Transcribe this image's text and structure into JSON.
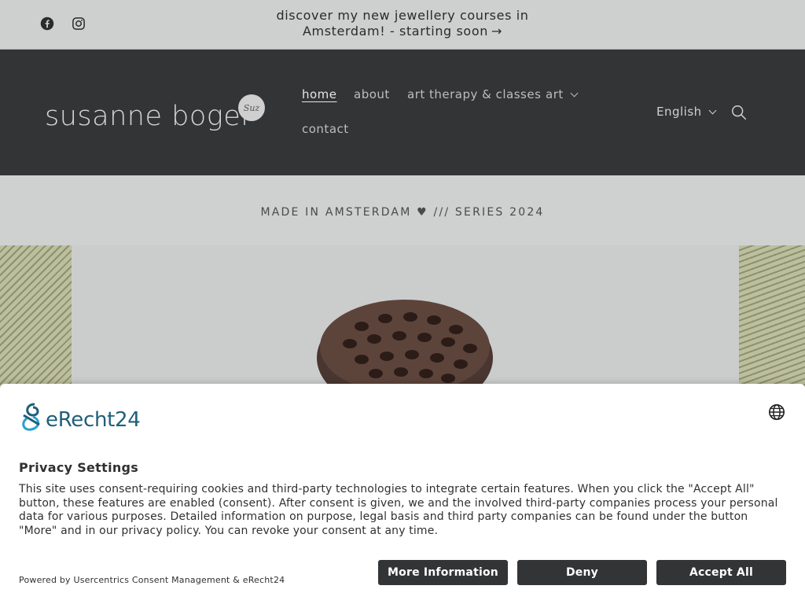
{
  "announcement": {
    "line1": "discover my new jewellery courses in",
    "line2": "Amsterdam! - starting soon",
    "arrow": "→"
  },
  "social": {
    "facebook_icon": "facebook-icon",
    "instagram_icon": "instagram-icon"
  },
  "header": {
    "logo_text": "susanne boger",
    "logo_badge": "Suz",
    "nav": [
      {
        "label": "home",
        "active": true
      },
      {
        "label": "about"
      },
      {
        "label": "art therapy & classes"
      },
      {
        "label": "art"
      },
      {
        "label": "contact"
      }
    ],
    "language": "English",
    "search_icon": "search-icon"
  },
  "content": {
    "tagline": "MADE IN AMSTERDAM ♥ /// SERIES 2024"
  },
  "consent": {
    "brand": "eRecht24",
    "title": "Privacy Settings",
    "body": "This site uses consent-requiring cookies and third-party technologies to integrate certain features. When you click the \"Accept All\" button, these features are enabled (consent). After consent is given, we and the involved third-party companies process your personal data for various purposes. Detailed information on purpose, legal basis and third party companies can be found under the button \"More\" and in our privacy policy. You can revoke your consent at any time.",
    "powered_by": "Powered by Usercentrics Consent Management & eRecht24",
    "buttons": {
      "more": "More Information",
      "deny": "Deny",
      "accept": "Accept All"
    }
  },
  "colors": {
    "header_bg": "#333435",
    "announce_bg": "#ced0d0",
    "button_bg": "#333435",
    "brand_blue": "#1f5f7a"
  }
}
